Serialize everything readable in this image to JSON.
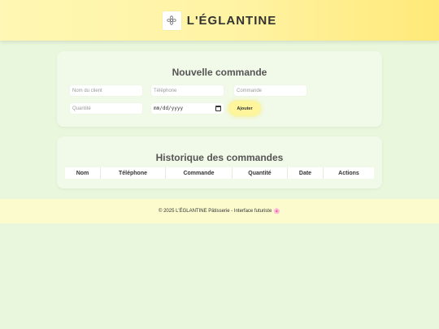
{
  "header": {
    "brand": "L'ÉGLANTINE",
    "logo_icon": "flower-logo-icon"
  },
  "order_form": {
    "title": "Nouvelle commande",
    "client_placeholder": "Nom du client",
    "phone_placeholder": "Téléphone",
    "order_placeholder": "Commande",
    "quantity_placeholder": "Quantité",
    "date_value": "mm/dd/yyyy",
    "add_label": "Ajouter"
  },
  "history": {
    "title": "Historique des commandes",
    "columns": [
      "Nom",
      "Téléphone",
      "Commande",
      "Quantité",
      "Date",
      "Actions"
    ]
  },
  "footer": {
    "text": "© 2025 L'ÉGLANTINE Pâtisserie - Interface futuriste",
    "flower": "🌸"
  },
  "colors": {
    "background": "#e9f7dc",
    "header_yellow": "#fff3a3",
    "button_yellow": "#fff59d",
    "card": "#f1f9e8",
    "footer": "#fbfbcd"
  }
}
